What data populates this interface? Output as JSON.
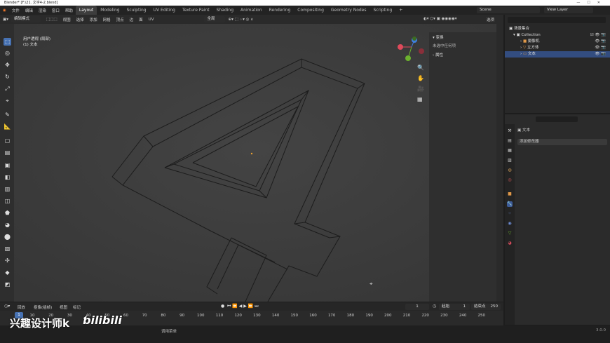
{
  "window": {
    "title": "Blender* [F:\\21. 文字4-2.blend]"
  },
  "menu": [
    "文件",
    "编辑",
    "渲染",
    "窗口",
    "帮助"
  ],
  "workspaces": [
    "Layout",
    "Modeling",
    "Sculpting",
    "UV Editing",
    "Texture Paint",
    "Shading",
    "Animation",
    "Rendering",
    "Compositing",
    "Geometry Nodes",
    "Scripting"
  ],
  "active_workspace": "Layout",
  "scene": "Scene",
  "view_layer": "View Layer",
  "viewport_header": {
    "mode": "编辑模式",
    "menus": [
      "视图",
      "选择",
      "添加",
      "网格",
      "顶点",
      "边",
      "面",
      "UV"
    ],
    "orientation": "全局",
    "options": "选项"
  },
  "viewport": {
    "info_line1": "用户透视 (局部)",
    "info_line2": "(1) 文本"
  },
  "sidepanel": {
    "section1": "变换",
    "text": "未选中任何项",
    "section2": "属性"
  },
  "outliner": {
    "root": "场景集合",
    "collection": "Collection",
    "items": [
      "摄像机",
      "立方体",
      "文本"
    ]
  },
  "properties": {
    "object": "文本",
    "add_modifier": "添加修改器"
  },
  "timeline": {
    "menus": [
      "回放",
      "抠像(插帧)",
      "视图",
      "标记"
    ],
    "current_frame": "1",
    "start_label": "起始",
    "start": "1",
    "end_label": "结束点",
    "end": "250",
    "ticks": [
      "10",
      "20",
      "30",
      "40",
      "50",
      "60",
      "70",
      "80",
      "90",
      "100",
      "110",
      "120",
      "130",
      "140",
      "150",
      "160",
      "170",
      "180",
      "190",
      "200",
      "210",
      "220",
      "230",
      "240",
      "250"
    ]
  },
  "status": {
    "hint": "调用菜单",
    "version": "3.0.0"
  },
  "watermark": {
    "text": "兴趣设计师k"
  },
  "colors": {
    "accent": "#4772b3",
    "axis_x": "#e04a5b",
    "axis_y": "#6cb22e",
    "axis_z": "#3f7fe0"
  }
}
